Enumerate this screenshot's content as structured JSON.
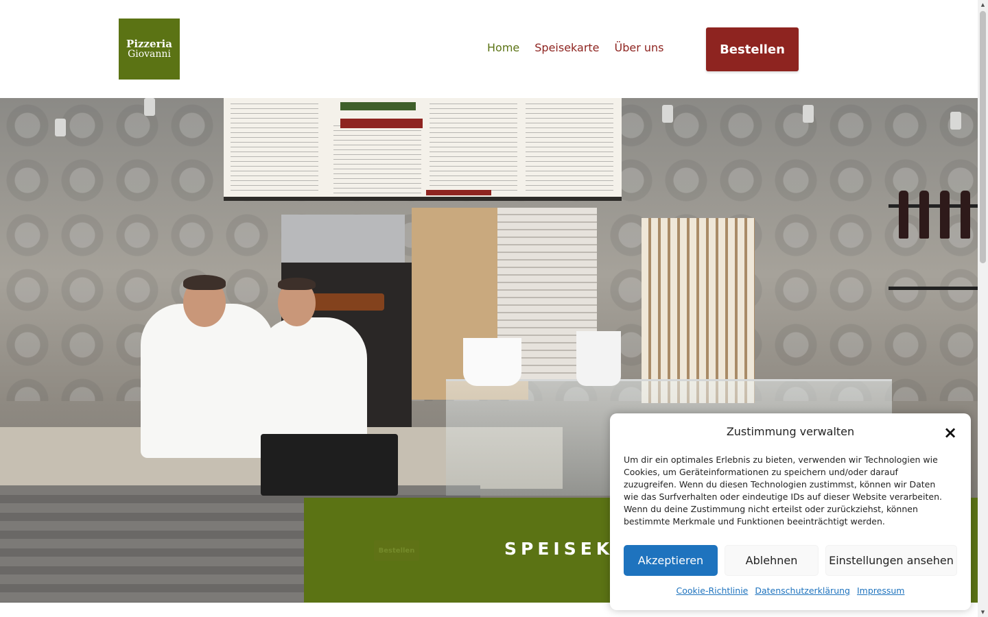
{
  "header": {
    "logo_line1": "Pizzeria",
    "logo_line2": "Giovanni",
    "nav": {
      "home": "Home",
      "menu": "Speisekarte",
      "about": "Über uns"
    },
    "order_button": "Bestellen"
  },
  "hero": {
    "banner_button": "Bestellen",
    "banner_title": "SPEISEKA"
  },
  "consent": {
    "title": "Zustimmung verwalten",
    "close_icon": "×",
    "text": "Um dir ein optimales Erlebnis zu bieten, verwenden wir Technologien wie Cookies, um Geräteinformationen zu speichern und/oder darauf zuzugreifen. Wenn du diesen Technologien zustimmst, können wir Daten wie das Surfverhalten oder eindeutige IDs auf dieser Website verarbeiten. Wenn du deine Zustimmung nicht erteilst oder zurückziehst, können bestimmte Merkmale und Funktionen beeinträchtigt werden.",
    "accept": "Akzeptieren",
    "deny": "Ablehnen",
    "preferences": "Einstellungen ansehen",
    "links": {
      "cookie_policy": "Cookie-Richtlinie",
      "privacy": "Datenschutzerklärung",
      "imprint": "Impressum"
    }
  },
  "colors": {
    "brand_green": "#5b7314",
    "brand_red": "#8e2420",
    "consent_blue": "#1e73be"
  }
}
